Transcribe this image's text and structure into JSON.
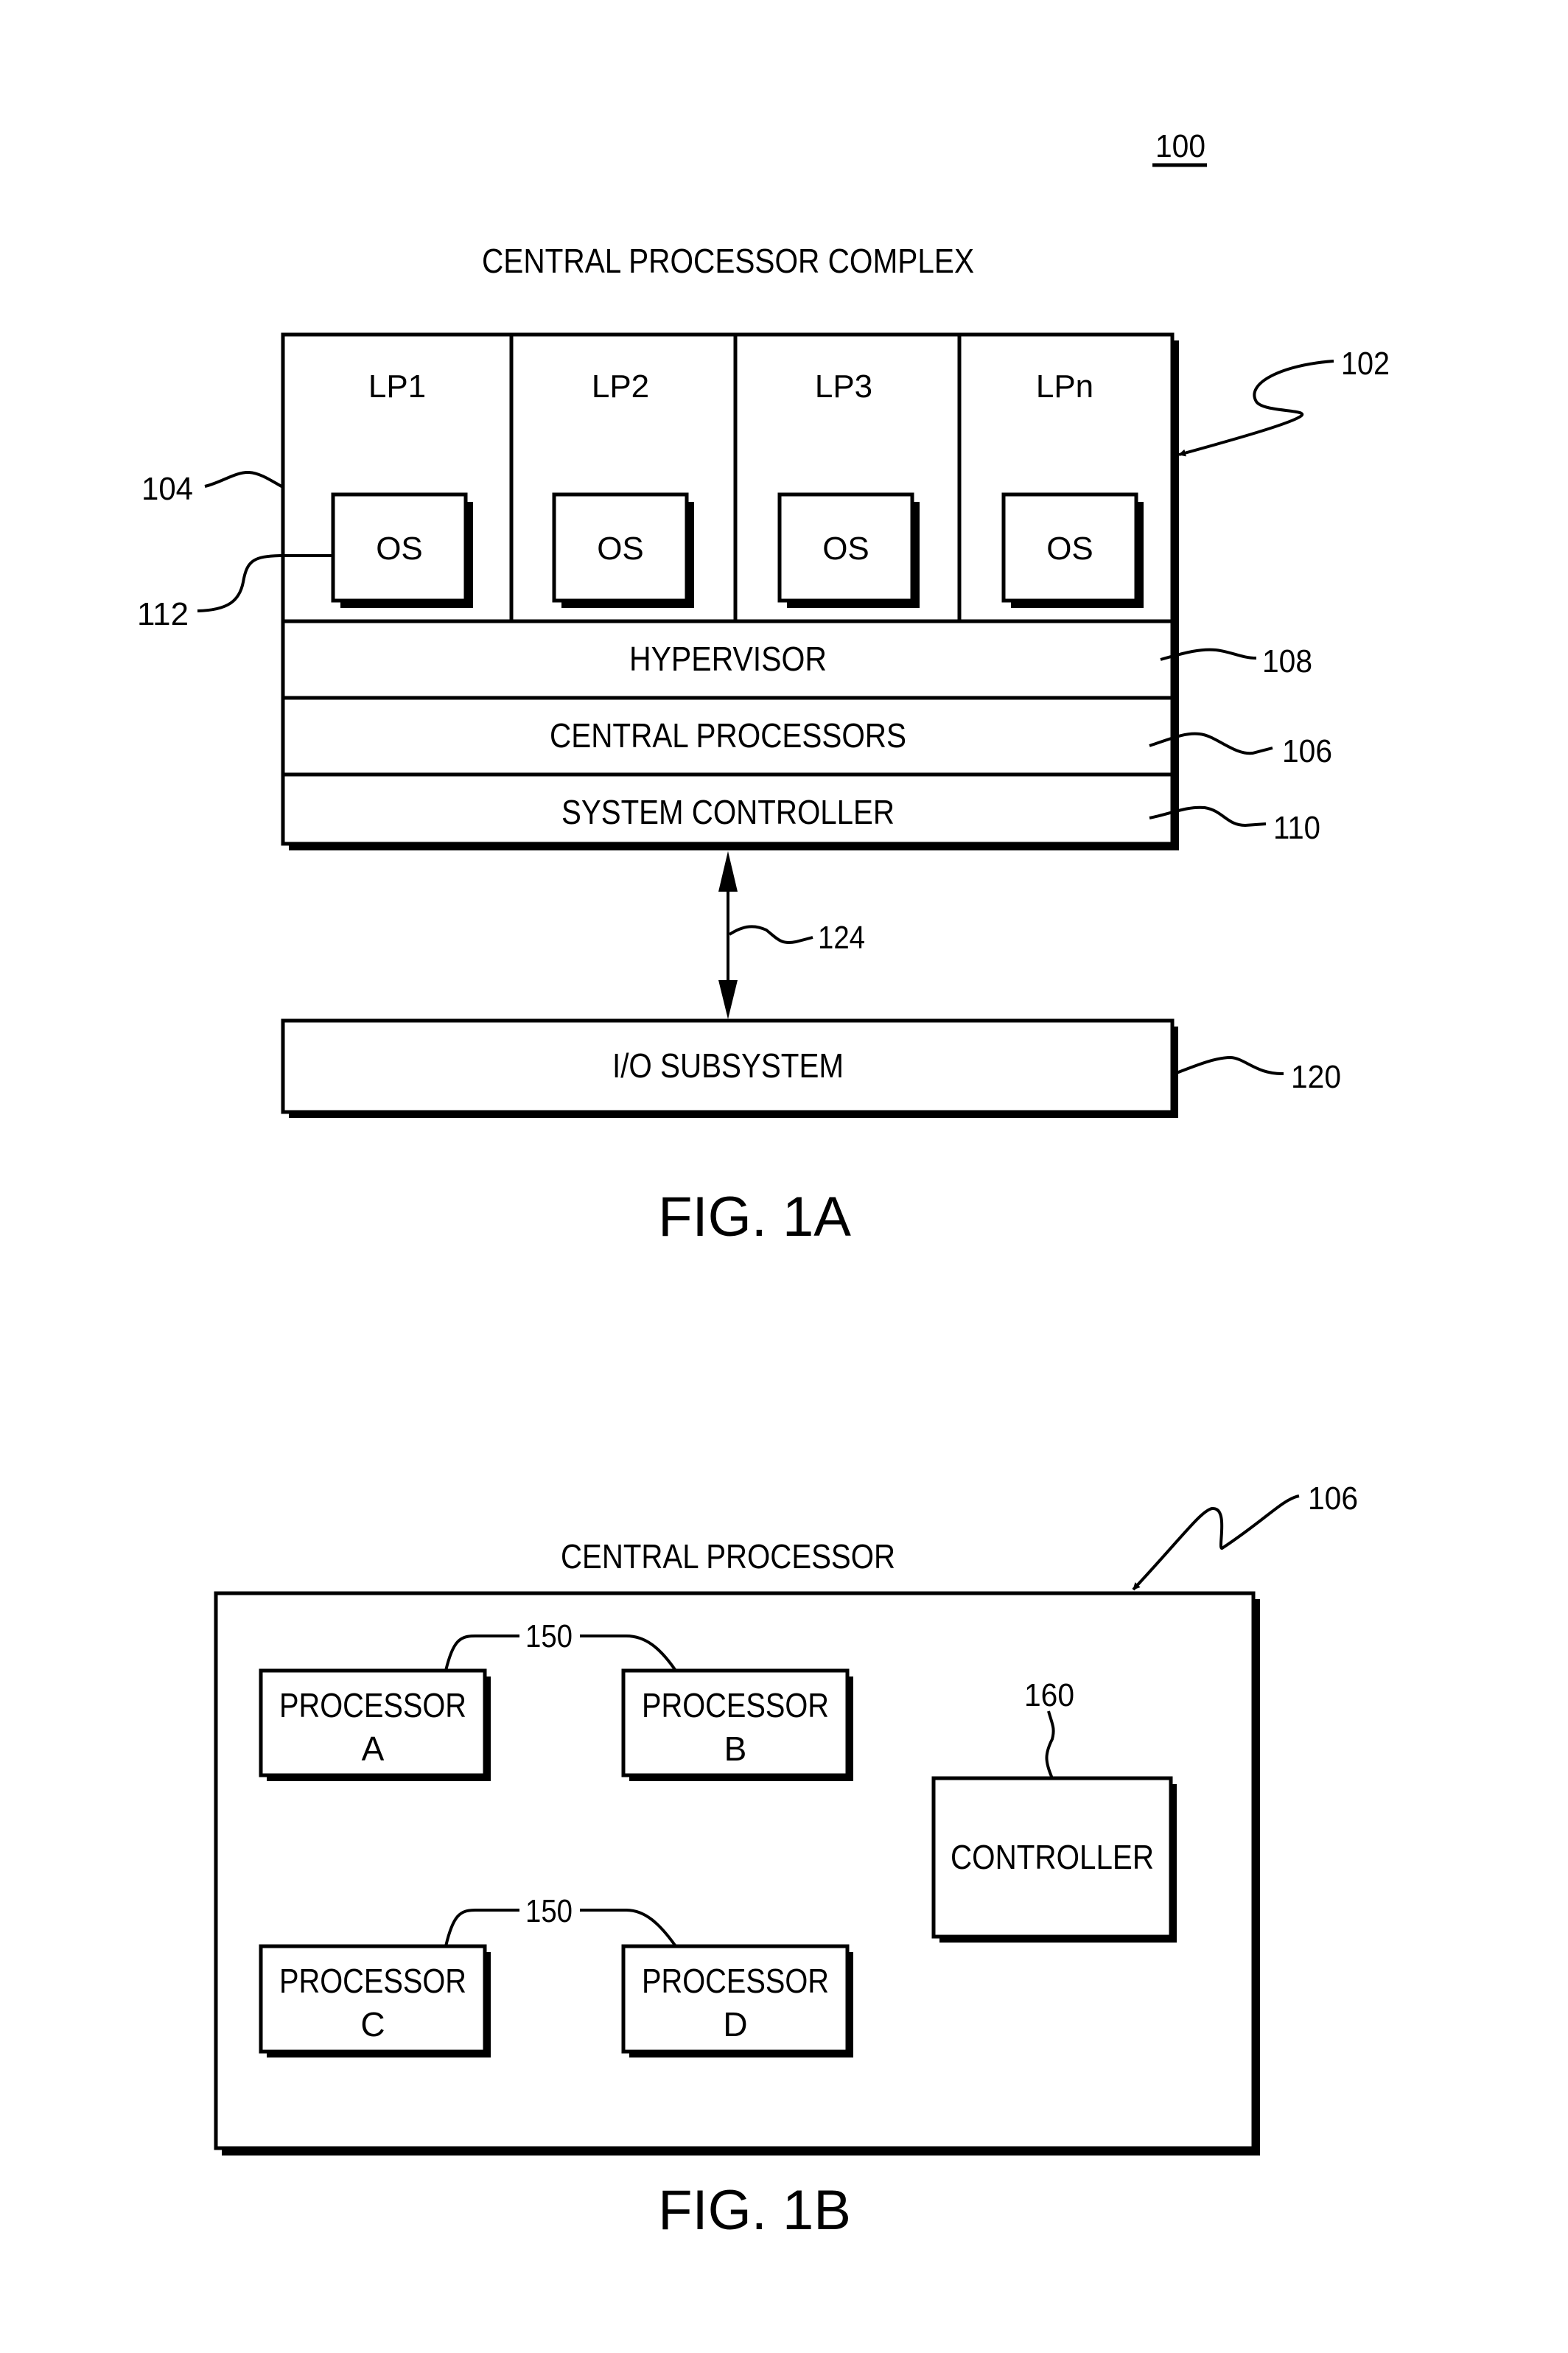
{
  "figure_ref": "100",
  "fig1a": {
    "title": "CENTRAL PROCESSOR COMPLEX",
    "caption": "FIG. 1A",
    "partitions": [
      {
        "label": "LP1",
        "os_label": "OS"
      },
      {
        "label": "LP2",
        "os_label": "OS"
      },
      {
        "label": "LP3",
        "os_label": "OS"
      },
      {
        "label": "LPn",
        "os_label": "OS"
      }
    ],
    "layers": {
      "hypervisor": "HYPERVISOR",
      "central_processors": "CENTRAL PROCESSORS",
      "system_controller": "SYSTEM CONTROLLER"
    },
    "io_subsystem": "I/O SUBSYSTEM",
    "refs": {
      "complex": "102",
      "partition": "104",
      "os": "112",
      "hypervisor": "108",
      "central_processors": "106",
      "system_controller": "110",
      "link": "124",
      "io_subsystem": "120"
    }
  },
  "fig1b": {
    "title": "CENTRAL PROCESSOR",
    "caption": "FIG. 1B",
    "processors": [
      {
        "line1": "PROCESSOR",
        "line2": "A"
      },
      {
        "line1": "PROCESSOR",
        "line2": "B"
      },
      {
        "line1": "PROCESSOR",
        "line2": "C"
      },
      {
        "line1": "PROCESSOR",
        "line2": "D"
      }
    ],
    "controller": "CONTROLLER",
    "refs": {
      "central_processor": "106",
      "processor_pair_top": "150",
      "processor_pair_bottom": "150",
      "controller": "160"
    }
  }
}
